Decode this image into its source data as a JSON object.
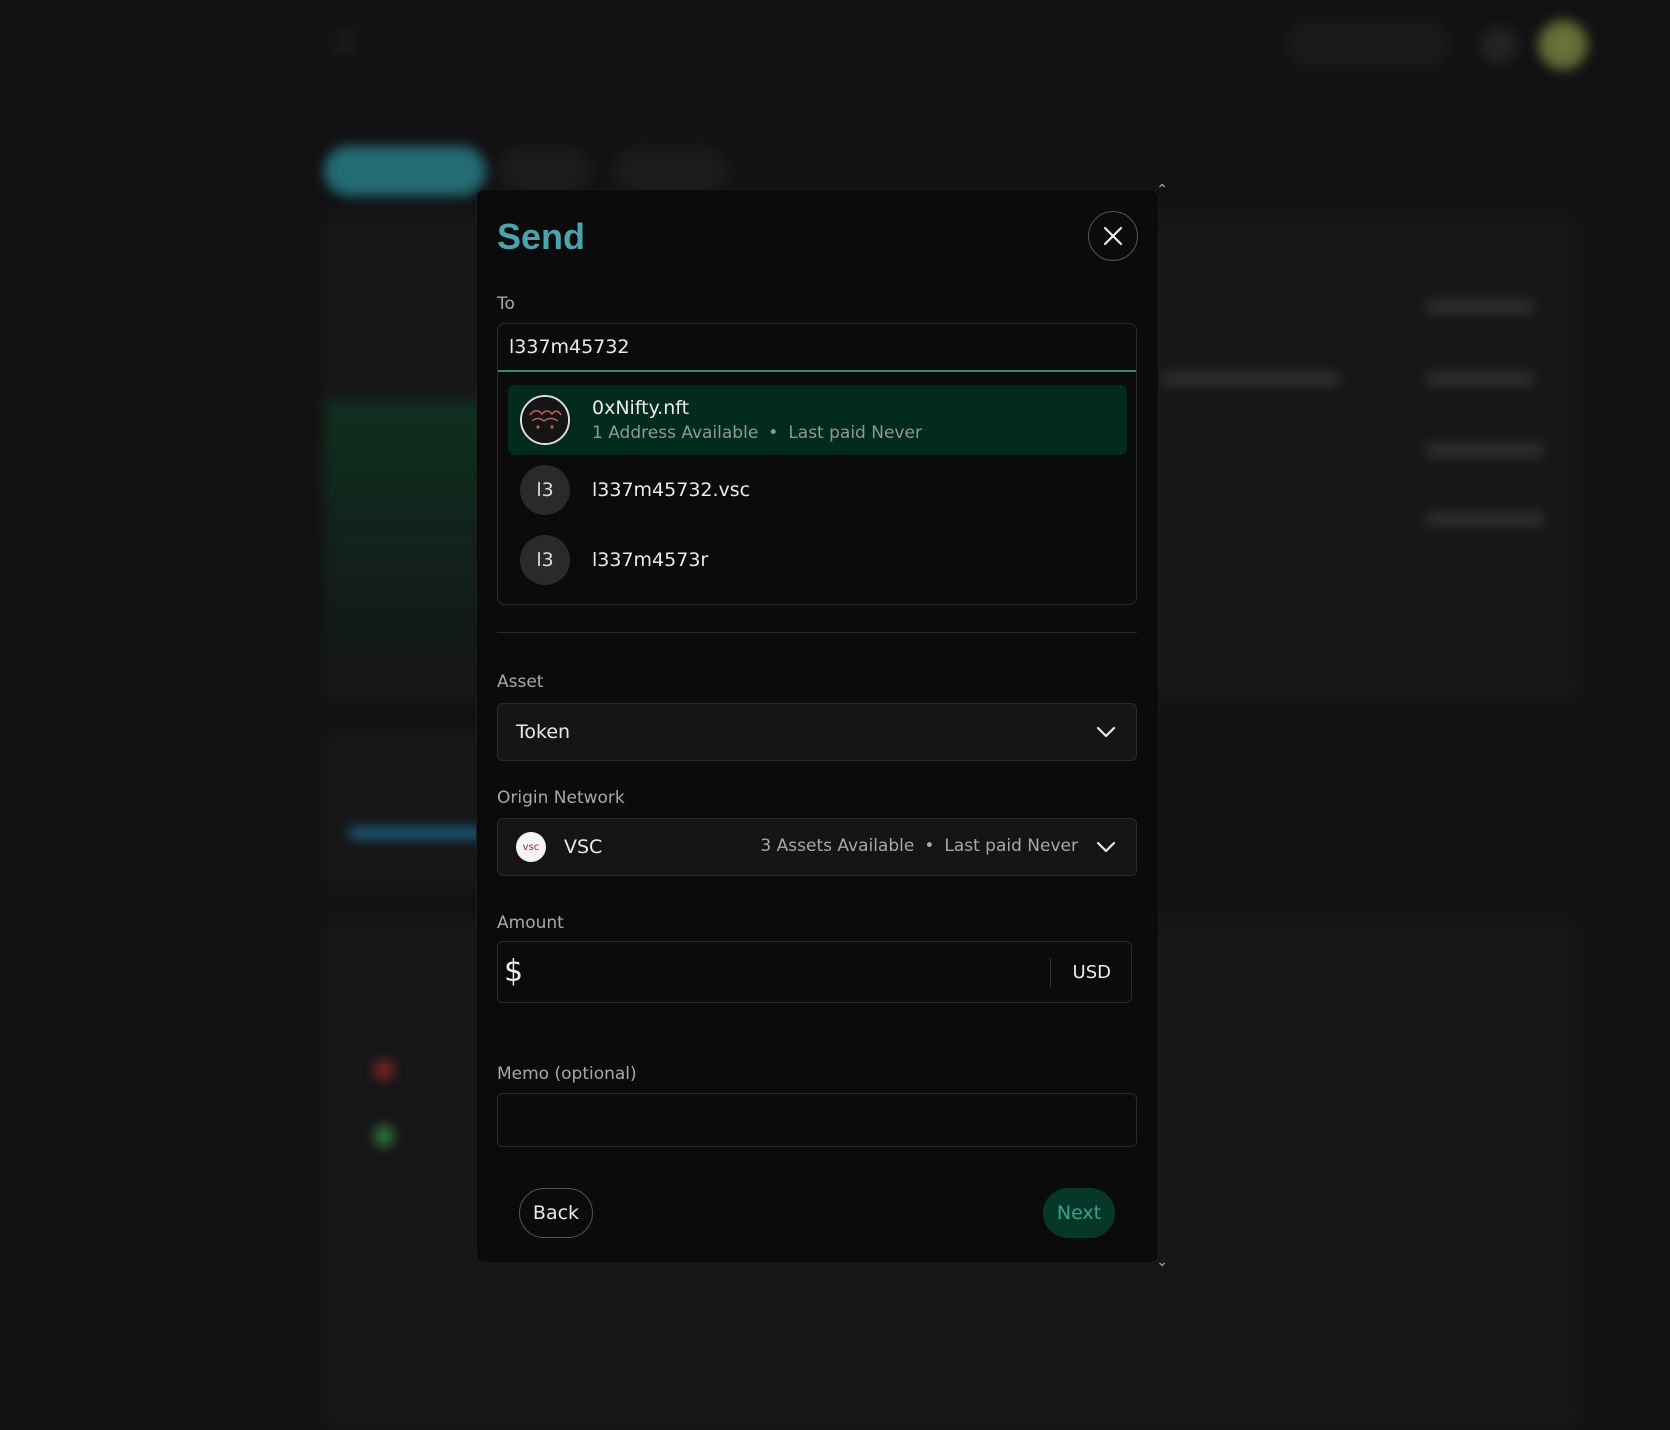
{
  "modal": {
    "title": "Send",
    "to": {
      "label": "To",
      "value": "l337m45732",
      "suggestions": [
        {
          "avatar": "nft-avatar",
          "name": "0xNifty.nft",
          "meta_addresses": "1 Address Available",
          "meta_last_paid": "Last paid Never"
        },
        {
          "avatar": "l3",
          "name": "l337m45732.vsc"
        },
        {
          "avatar": "l3",
          "name": "l337m4573r"
        }
      ]
    },
    "asset": {
      "label": "Asset",
      "value": "Token"
    },
    "origin_network": {
      "label": "Origin Network",
      "logo_text": "vsc",
      "name": "VSC",
      "meta_assets": "3 Assets Available",
      "meta_last_paid": "Last paid Never"
    },
    "amount": {
      "label": "Amount",
      "symbol": "$",
      "value": "",
      "unit": "USD"
    },
    "memo": {
      "label": "Memo (optional)",
      "value": ""
    },
    "buttons": {
      "back": "Back",
      "next": "Next"
    },
    "separator": "•"
  },
  "colors": {
    "accent": "#4aa3ad",
    "selected_bg": "#022b1e",
    "next_bg": "#06382a",
    "next_text": "#3da08a"
  }
}
